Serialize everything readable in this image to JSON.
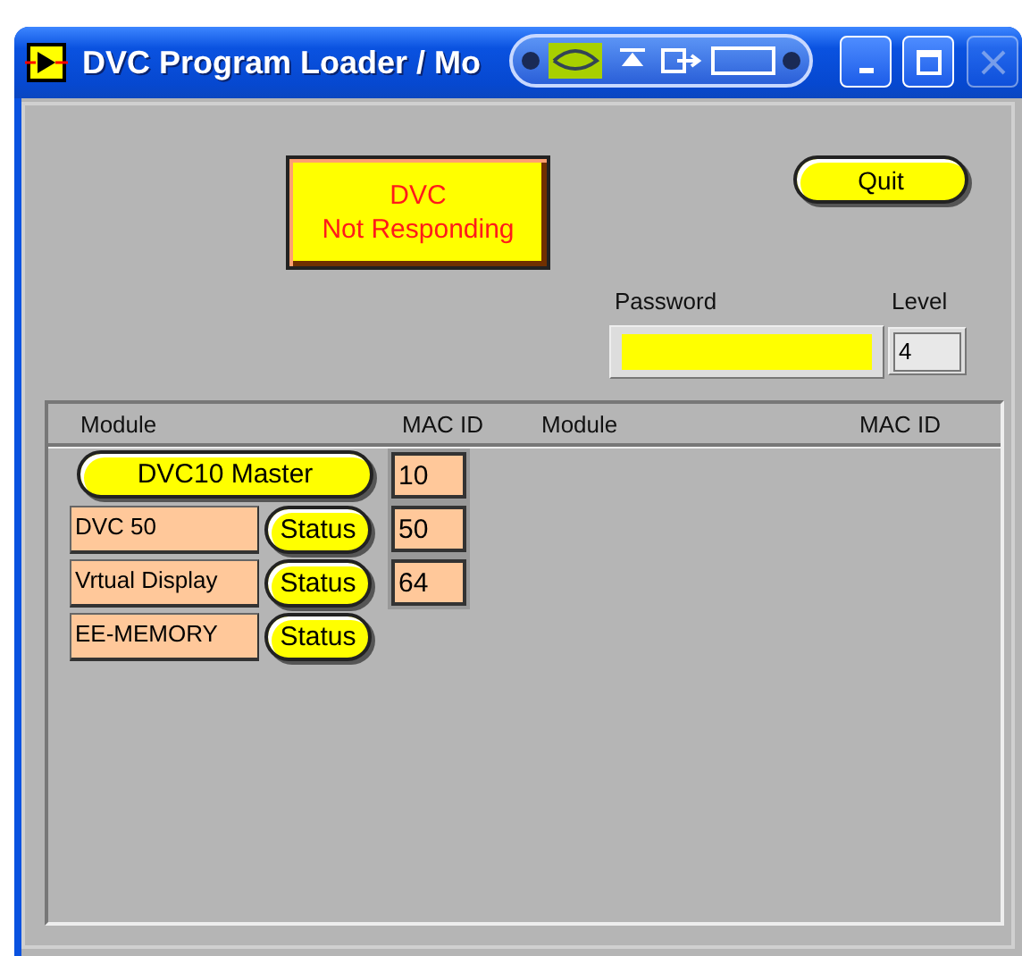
{
  "window": {
    "title": "DVC Program Loader / Mo",
    "close_disabled": true
  },
  "status_indicator": {
    "lines": [
      "DVC",
      "Not Responding"
    ]
  },
  "quit_button": {
    "label": "Quit"
  },
  "password": {
    "label": "Password"
  },
  "level": {
    "label": "Level",
    "value": "4"
  },
  "module_list": {
    "columns": [
      "Module",
      "MAC ID",
      "Module",
      "MAC ID"
    ],
    "master": {
      "label": "DVC10 Master",
      "mac_id": "10"
    },
    "modules": [
      {
        "name": "DVC 50",
        "status_button": "Status",
        "mac_id": "50"
      },
      {
        "name": "Vrtual Display",
        "status_button": "Status",
        "mac_id": "64"
      },
      {
        "name": "EE-MEMORY",
        "status_button": "Status"
      }
    ]
  }
}
